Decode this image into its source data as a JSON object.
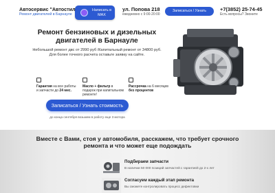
{
  "header": {
    "logo_title": "Автосервис \"Автостиль\"",
    "logo_subtitle": "Ремонт двигателей в Барнауле",
    "max_button": "Написать в MAX",
    "address": "ул. Попова 218",
    "hours": "ежедневно с 9:00-20:00",
    "signup_button": "Записаться / Узнать стоимость",
    "phone": "+7(3852) 25-74-45",
    "call_prompt": "Есть вопросы? Звоните"
  },
  "hero": {
    "title": "Ремонт бензиновых и дизельных двигателей в Барнауле",
    "description": "Небольшой ремонт двс от 2990 руб /Капитальный ремонт от 34800 руб. Для более точного расчета оставьте заявку на сайте.",
    "features": [
      {
        "lead": "Гарантия",
        "text": " на все работы и запчасти до ",
        "bold": "24 мес."
      },
      {
        "lead": "Масло + фильтр",
        "text": " в подарок при капитальном ремонте!",
        "bold": ""
      },
      {
        "lead": "Рассрочка",
        "text": " на 6 месяцев ",
        "bold": "без процентов"
      }
    ],
    "cta_button": "Записаться / Узнать стоимость",
    "cta_note": "до конца сентября возьмем в работу еще 3 мотора"
  },
  "section2": {
    "title": "Вместе с Вами, стоя у автомобиля, расскажем, что требует срочного ремонта и что может еще подождать",
    "items": [
      {
        "title": "Подбираем запчасти",
        "text": "В наличии 50 000 позиций запчастей с гарантией до 2-х лет"
      },
      {
        "title": "Согласуем каждый этап ремонта",
        "text": "Вы сможете контролировать процесс дефектовки"
      }
    ]
  },
  "colors": {
    "accent": "#2c5ad2",
    "text": "#1d1d1f"
  }
}
